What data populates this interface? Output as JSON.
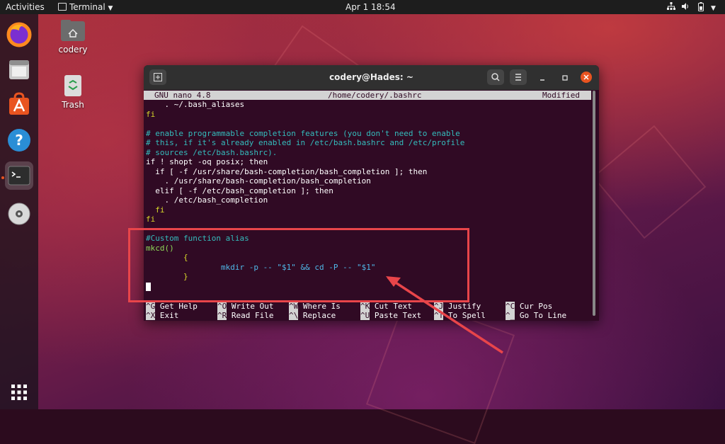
{
  "topbar": {
    "activities": "Activities",
    "app_menu": "Terminal",
    "clock": "Apr 1  18:54"
  },
  "desktop_icons": [
    {
      "label": "codery"
    },
    {
      "label": "Trash"
    }
  ],
  "window": {
    "title": "codery@Hades: ~"
  },
  "nano": {
    "version": "GNU nano 4.8",
    "file": "/home/codery/.bashrc",
    "status": "Modified",
    "lines": [
      "    . ~/.bash_aliases",
      "fi",
      "",
      "# enable programmable completion features (you don't need to enable",
      "# this, if it's already enabled in /etc/bash.bashrc and /etc/profile",
      "# sources /etc/bash.bashrc).",
      "if ! shopt -oq posix; then",
      "  if [ -f /usr/share/bash-completion/bash_completion ]; then",
      "    . /usr/share/bash-completion/bash_completion",
      "  elif [ -f /etc/bash_completion ]; then",
      "    . /etc/bash_completion",
      "  fi",
      "fi",
      "",
      "#Custom function alias",
      "mkcd()",
      "        {",
      "                mkdir -p -- \"$1\" && cd -P -- \"$1\"",
      "        }"
    ],
    "shortcuts": [
      {
        "key": "^G",
        "label": "Get Help"
      },
      {
        "key": "^O",
        "label": "Write Out"
      },
      {
        "key": "^W",
        "label": "Where Is"
      },
      {
        "key": "^K",
        "label": "Cut Text"
      },
      {
        "key": "^J",
        "label": "Justify"
      },
      {
        "key": "^C",
        "label": "Cur Pos"
      },
      {
        "key": "^X",
        "label": "Exit"
      },
      {
        "key": "^R",
        "label": "Read File"
      },
      {
        "key": "^\\",
        "label": "Replace"
      },
      {
        "key": "^U",
        "label": "Paste Text"
      },
      {
        "key": "^T",
        "label": "To Spell"
      },
      {
        "key": "^_",
        "label": "Go To Line"
      }
    ]
  },
  "colors": {
    "terminal_bg": "#300a24",
    "annotation": "#e8454a",
    "ubuntu_orange": "#e95420"
  }
}
